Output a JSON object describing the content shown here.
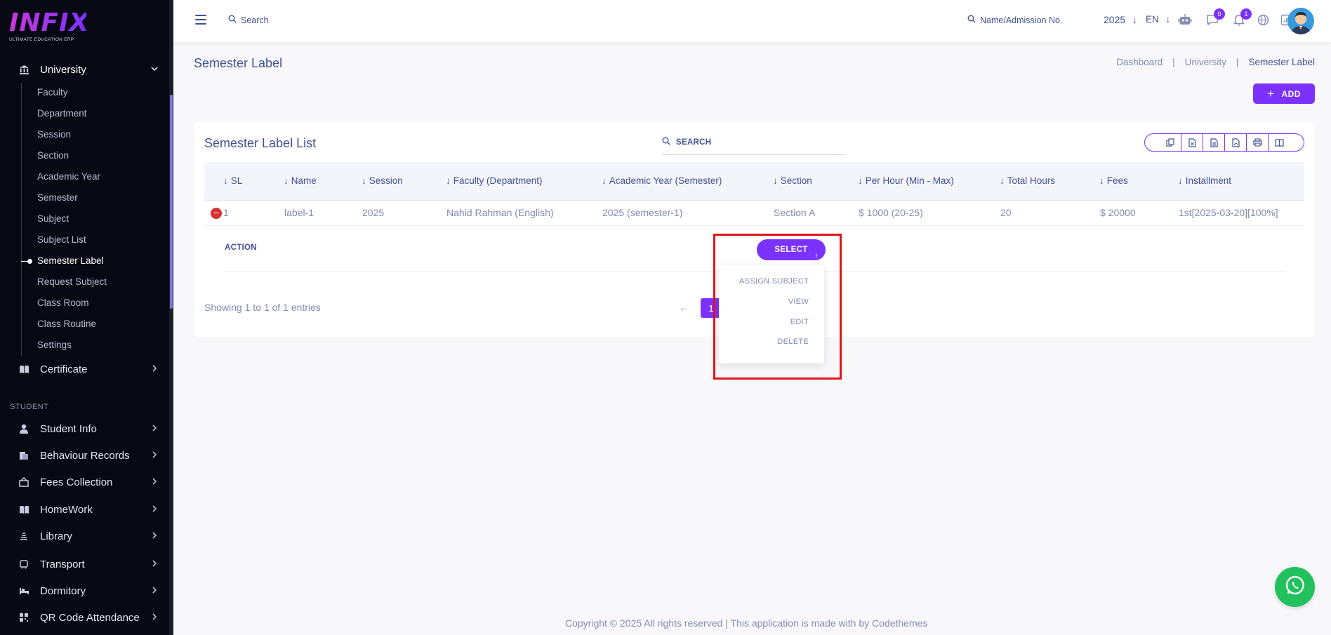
{
  "sidebar": {
    "logo_text": "INFIX",
    "logo_tagline": "ULTIMATE EDUCATION ERP",
    "university": {
      "label": "University",
      "icon": "university-icon"
    },
    "university_items": [
      {
        "label": "Faculty"
      },
      {
        "label": "Department"
      },
      {
        "label": "Session"
      },
      {
        "label": "Section"
      },
      {
        "label": "Academic Year"
      },
      {
        "label": "Semester"
      },
      {
        "label": "Subject"
      },
      {
        "label": "Subject List"
      },
      {
        "label": "Semester Label",
        "active": true
      },
      {
        "label": "Request Subject"
      },
      {
        "label": "Class Room"
      },
      {
        "label": "Class Routine"
      },
      {
        "label": "Settings"
      }
    ],
    "certificate": {
      "label": "Certificate",
      "icon": "book-icon"
    },
    "section_label": "STUDENT",
    "student_menu": [
      {
        "label": "Student Info",
        "icon": "user-icon"
      },
      {
        "label": "Behaviour Records",
        "icon": "records-icon"
      },
      {
        "label": "Fees Collection",
        "icon": "fees-icon"
      },
      {
        "label": "HomeWork",
        "icon": "book-icon"
      },
      {
        "label": "Library",
        "icon": "library-icon"
      },
      {
        "label": "Transport",
        "icon": "bus-icon"
      },
      {
        "label": "Dormitory",
        "icon": "bed-icon"
      },
      {
        "label": "QR Code Attendance",
        "icon": "qr-icon"
      }
    ]
  },
  "header": {
    "search_placeholder": "Search",
    "admission_search_placeholder": "Name/Admission No.",
    "year": "2025",
    "language": "EN",
    "messages_count": "0",
    "notifications_count": "1"
  },
  "page": {
    "title": "Semester Label",
    "breadcrumb": [
      "Dashboard",
      "University",
      "Semester Label"
    ],
    "add_label": "ADD"
  },
  "table": {
    "title": "Semester Label List",
    "search_placeholder": "SEARCH",
    "export_buttons": [
      "copy-icon",
      "excel-icon",
      "csv-icon",
      "pdf-icon",
      "print-icon",
      "columns-icon"
    ],
    "columns": [
      "SL",
      "Name",
      "Session",
      "Faculty (Department)",
      "Academic Year (Semester)",
      "Section",
      "Per Hour (Min - Max)",
      "Total Hours",
      "Fees",
      "Installment"
    ],
    "rows": [
      {
        "cells": [
          "1",
          "label-1",
          "2025",
          "Nahid Rahman (English)",
          "2025 (semester-1)",
          "Section A",
          "$ 1000 (20-25)",
          "20",
          "$ 20000",
          "1st[2025-03-20][100%]"
        ]
      }
    ],
    "child_action_label": "ACTION",
    "select_label": "SELECT",
    "dropdown": [
      "ASSIGN SUBJECT",
      "VIEW",
      "EDIT",
      "DELETE"
    ],
    "showing": "Showing 1 to 1 of 1 entries",
    "current_page": "1"
  },
  "footer": {
    "text": "Copyright © 2025 All rights reserved | This application is made with by Codethemes"
  },
  "colors": {
    "accent": "#7c32ff",
    "sidebar_bg": "#070814",
    "text": "#415094",
    "muted": "#828bb2",
    "highlight": "#e0141c",
    "whatsapp": "#22c15e"
  }
}
